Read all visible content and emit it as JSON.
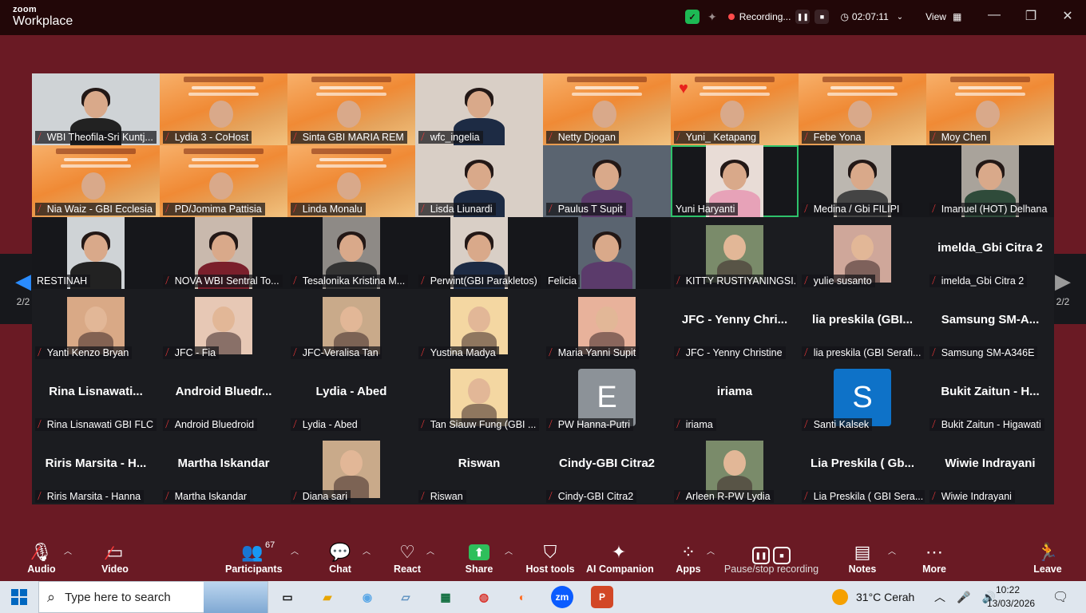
{
  "app": {
    "brand_top": "zoom",
    "brand_bottom": "Workplace",
    "recording_text": "Recording...",
    "timer": "02:07:11",
    "view_label": "View"
  },
  "gallery": {
    "page_label_left": "2/2",
    "page_label_right": "2/2",
    "tiles": [
      {
        "name": "WBI Theofila-Sri Kuntj...",
        "kind": "cam"
      },
      {
        "name": "Lydia 3 - CoHost",
        "kind": "poster"
      },
      {
        "name": "Sinta GBI MARIA REM",
        "kind": "poster"
      },
      {
        "name": "wfc_ingelia",
        "kind": "cam"
      },
      {
        "name": "Netty Djogan",
        "kind": "poster"
      },
      {
        "name": "Yuni_ Ketapang",
        "kind": "poster"
      },
      {
        "name": "Febe Yona",
        "kind": "poster"
      },
      {
        "name": "Moy Chen",
        "kind": "poster"
      },
      {
        "name": "Nia Waiz - GBI Ecclesia",
        "kind": "poster"
      },
      {
        "name": "PD/Jomima Pattisia",
        "kind": "poster"
      },
      {
        "name": "Linda Monalu",
        "kind": "poster"
      },
      {
        "name": "Lisda Liunardi",
        "kind": "cam"
      },
      {
        "name": "Paulus T Supit",
        "kind": "cam"
      },
      {
        "name": "Yuni Haryanti",
        "kind": "cam"
      },
      {
        "name": "Medina / Gbi FILIPI",
        "kind": "cam"
      },
      {
        "name": "Imanuel (HOT) Delhana",
        "kind": "cam"
      },
      {
        "name": "RESTINAH",
        "kind": "cam"
      },
      {
        "name": "NOVA WBI Sentral To...",
        "kind": "cam"
      },
      {
        "name": "Tesalonika Kristina M...",
        "kind": "cam"
      },
      {
        "name": "Perwint(GBI Parakletos)",
        "kind": "cam"
      },
      {
        "name": "Felicia",
        "kind": "cam"
      },
      {
        "name": "KITTY RUSTIYANINGSI...",
        "kind": "thumb"
      },
      {
        "name": "yulie susanto",
        "kind": "thumb"
      },
      {
        "name": "imelda_Gbi Citra 2",
        "kind": "text",
        "big": "imelda_Gbi Citra 2"
      },
      {
        "name": "Yanti Kenzo Bryan",
        "kind": "thumb"
      },
      {
        "name": "JFC - Fia",
        "kind": "thumb"
      },
      {
        "name": "JFC-Veralisa Tan",
        "kind": "thumb"
      },
      {
        "name": "Yustina Madya",
        "kind": "thumb"
      },
      {
        "name": "Maria Yanni Supit",
        "kind": "thumb"
      },
      {
        "name": "JFC - Yenny Christine",
        "kind": "text",
        "big": "JFC - Yenny Chri..."
      },
      {
        "name": "lia preskila (GBI Serafi...",
        "kind": "text",
        "big": "lia preskila (GBI..."
      },
      {
        "name": "Samsung SM-A346E",
        "kind": "text",
        "big": "Samsung SM-A..."
      },
      {
        "name": "Rina Lisnawati GBI FLC",
        "kind": "text",
        "big": "Rina Lisnawati..."
      },
      {
        "name": "Android Bluedroid",
        "kind": "text",
        "big": "Android Bluedr..."
      },
      {
        "name": "Lydia - Abed",
        "kind": "text",
        "big": "Lydia - Abed"
      },
      {
        "name": "Tan Siauw Fung (GBI ...",
        "kind": "thumb"
      },
      {
        "name": "PW Hanna-Putri",
        "kind": "letter",
        "letter": "E"
      },
      {
        "name": "iriama",
        "kind": "text",
        "big": "iriama"
      },
      {
        "name": "Santi Kalsek",
        "kind": "letter",
        "letter": "S"
      },
      {
        "name": "Bukit Zaitun - Higawati",
        "kind": "text",
        "big": "Bukit Zaitun - H..."
      },
      {
        "name": "Riris Marsita - Hanna",
        "kind": "text",
        "big": "Riris Marsita - H..."
      },
      {
        "name": "Martha Iskandar",
        "kind": "text",
        "big": "Martha Iskandar"
      },
      {
        "name": "Diana sari",
        "kind": "thumb"
      },
      {
        "name": "Riswan",
        "kind": "text",
        "big": "Riswan"
      },
      {
        "name": "Cindy-GBI Citra2",
        "kind": "text",
        "big": "Cindy-GBI Citra2"
      },
      {
        "name": "Arleen R-PW Lydia",
        "kind": "thumb"
      },
      {
        "name": "Lia Preskila ( GBI Sera...",
        "kind": "text",
        "big": "Lia Preskila ( Gb..."
      },
      {
        "name": "Wiwie Indrayani",
        "kind": "text",
        "big": "Wiwie Indrayani"
      }
    ]
  },
  "toolbar": {
    "audio": "Audio",
    "video": "Video",
    "participants": "Participants",
    "participants_count": "67",
    "chat": "Chat",
    "react": "React",
    "share": "Share",
    "host_tools": "Host tools",
    "ai_companion": "AI Companion",
    "apps": "Apps",
    "pause_stop": "Pause/stop recording",
    "notes": "Notes",
    "more": "More",
    "leave": "Leave"
  },
  "taskbar": {
    "search_placeholder": "Type here to search",
    "weather": "31°C  Cerah",
    "time": "10:22",
    "date": "13/03/2026"
  },
  "colors": {
    "window_bg": "#6a1a24",
    "titlebar_bg": "#220708",
    "active_speaker": "#2ec26b",
    "share_green": "#2ebf5b",
    "mute_red": "#ff3b3b"
  }
}
